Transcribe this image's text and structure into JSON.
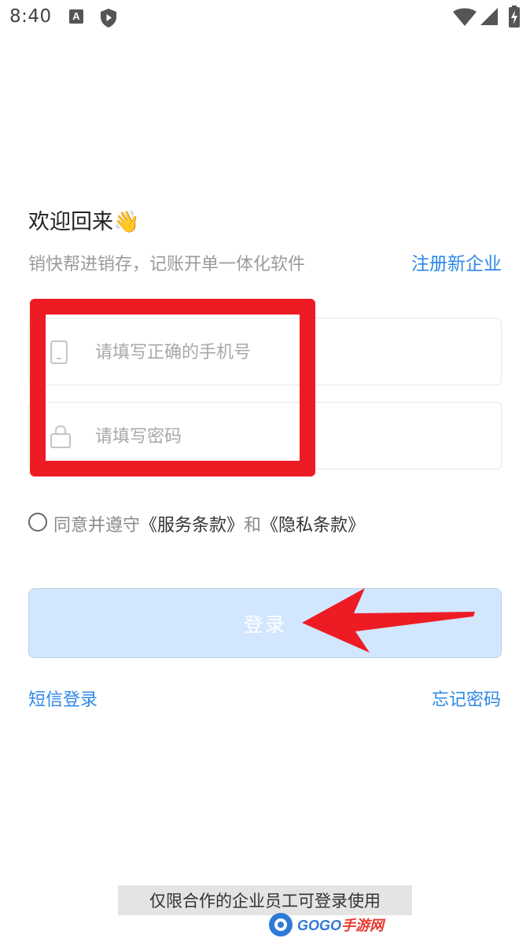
{
  "status_bar": {
    "time": "8:40",
    "icons": [
      "a-notification-icon",
      "shield-icon",
      "wifi-icon",
      "signal-icon",
      "battery-icon"
    ]
  },
  "header": {
    "title": "欢迎回来👋",
    "subtitle": "销快帮进销存，记账开单一体化软件",
    "register_link": "注册新企业"
  },
  "form": {
    "phone_placeholder": "请填写正确的手机号",
    "phone_value": "",
    "password_placeholder": "请填写密码",
    "password_value": ""
  },
  "agreement": {
    "checked": false,
    "prefix": "同意并遵守",
    "terms_label": "《服务条款》",
    "and": "和",
    "privacy_label": "《隐私条款》"
  },
  "login_button": {
    "label": "登录",
    "enabled": false
  },
  "links": {
    "sms_login": "短信登录",
    "forgot_password": "忘记密码"
  },
  "footer": {
    "notice": "仅限合作的企业员工可登录使用"
  },
  "watermark": {
    "text_main": "GOGO",
    "text_accent": "手游网"
  },
  "colors": {
    "accent": "#2d87e6",
    "button_disabled_bg": "#d2e6fd",
    "annotation_red": "#ed1c24"
  }
}
